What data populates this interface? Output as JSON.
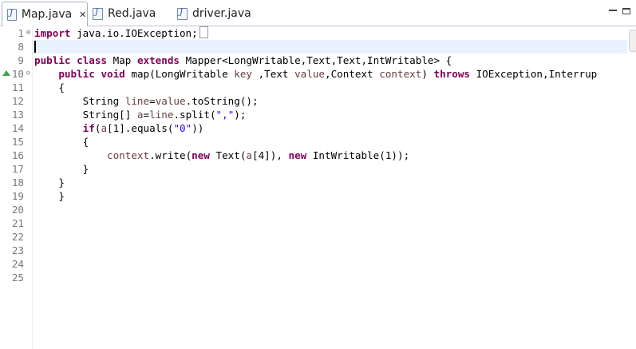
{
  "tabs": [
    {
      "label": "Map.java",
      "active": true,
      "closable": true
    },
    {
      "label": "Red.java",
      "active": false
    },
    {
      "label": "driver.java",
      "active": false
    }
  ],
  "window_controls": {
    "minimize_icon": "minimize-icon",
    "maximize_icon": "maximize-icon"
  },
  "editor": {
    "line_numbers": [
      "1",
      "8",
      "9",
      "10",
      "11",
      "12",
      "13",
      "14",
      "15",
      "16",
      "17",
      "18",
      "19",
      "20",
      "21",
      "22",
      "23",
      "24",
      "25"
    ],
    "code": {
      "l1_kw": "import",
      "l1_rest": " java.io.IOException;",
      "l9_kw1": "public",
      "l9_kw2": "class",
      "l9_mid": " Map ",
      "l9_kw3": "extends",
      "l9_rest": " Mapper<LongWritable,Text,Text,IntWritable> {",
      "l10_kw1": "public",
      "l10_kw2": "void",
      "l10_a": " map(LongWritable ",
      "l10_key": "key",
      "l10_b": " ,Text ",
      "l10_value": "value",
      "l10_c": ",Context ",
      "l10_context": "context",
      "l10_d": ") ",
      "l10_throws": "throws",
      "l10_e": " IOException,Interrup",
      "l11": "{",
      "l12_a": "String ",
      "l12_line": "line",
      "l12_b": "=",
      "l12_value": "value",
      "l12_c": ".toString();",
      "l13_a": "String[] ",
      "l13_a2": "a",
      "l13_b": "=",
      "l13_line": "line",
      "l13_c": ".split(",
      "l13_str": "\",\"",
      "l13_d": ");",
      "l14_kw": "if",
      "l14_a": "(",
      "l14_arr": "a",
      "l14_b": "[1].equals(",
      "l14_str": "\"0\"",
      "l14_c": "))",
      "l15": "{",
      "l16_context": "context",
      "l16_a": ".write(",
      "l16_new1": "new",
      "l16_b": " Text(",
      "l16_arr": "a",
      "l16_c": "[4]), ",
      "l16_new2": "new",
      "l16_d": " IntWritable(1));",
      "l17": "}",
      "l18": "}",
      "l19": "}"
    }
  },
  "colors": {
    "keyword": "#7f0055",
    "local_variable": "#6a3e3e",
    "string": "#2a00ff",
    "current_line": "#e8f2fe",
    "override_marker": "#3fa34d"
  }
}
